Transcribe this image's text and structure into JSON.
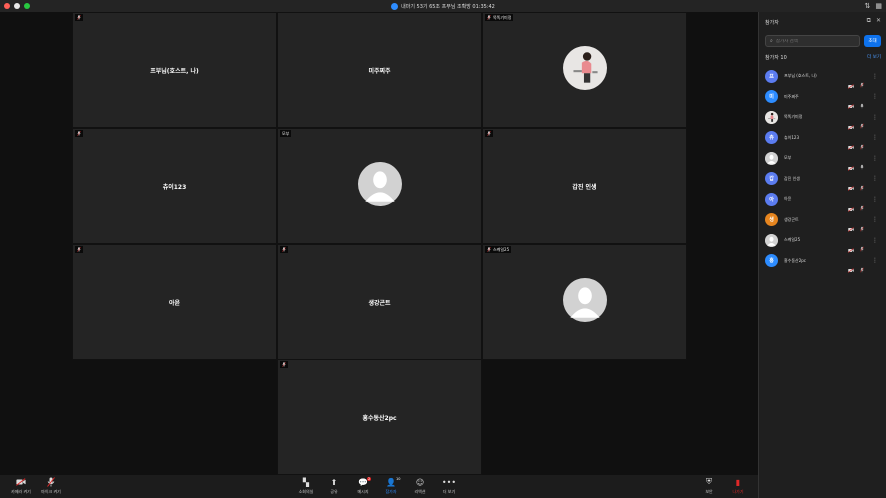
{
  "window": {
    "title": "내마기 53기 65조 프부님 조확방 01:35:42",
    "traffic": [
      "#ff5f57",
      "#e8e8e8",
      "#28c840"
    ]
  },
  "tiles": [
    {
      "name": "프부님(호스트, 나)",
      "label": "",
      "muted": true,
      "type": "name"
    },
    {
      "name": "미주찌주",
      "label": "",
      "muted": false,
      "type": "name"
    },
    {
      "name": "",
      "label": "똑똑기미정",
      "muted": true,
      "type": "photo"
    },
    {
      "name": "츄이123",
      "label": "",
      "muted": true,
      "type": "name"
    },
    {
      "name": "",
      "label": "모부",
      "muted": false,
      "type": "silhouette"
    },
    {
      "name": "갑진 인생",
      "label": "",
      "muted": true,
      "type": "name"
    },
    {
      "name": "아윤",
      "label": "",
      "muted": true,
      "type": "name"
    },
    {
      "name": "생강곤트",
      "label": "",
      "muted": true,
      "type": "name"
    },
    {
      "name": "",
      "label": "스케일25",
      "muted": true,
      "type": "silhouette"
    },
    {
      "name": "흥수동산2pc",
      "label": "",
      "muted": true,
      "type": "name"
    }
  ],
  "toolbar": {
    "left": [
      {
        "label": "카메라 켜기",
        "icon": "camera-off-icon"
      },
      {
        "label": "마이크 켜기",
        "icon": "mic-off-icon"
      }
    ],
    "center": [
      {
        "label": "소회의실",
        "icon": "breakout-icon"
      },
      {
        "label": "공유",
        "icon": "share-icon"
      },
      {
        "label": "메시지",
        "icon": "chat-icon",
        "badge": "2"
      },
      {
        "label": "참가자",
        "icon": "participants-icon",
        "badge": "10"
      },
      {
        "label": "리액션",
        "icon": "reaction-icon"
      },
      {
        "label": "더 보기",
        "icon": "more-icon"
      }
    ],
    "right": [
      {
        "label": "보안",
        "icon": "security-icon"
      },
      {
        "label": "나가기",
        "icon": "leave-icon"
      }
    ]
  },
  "panel": {
    "title": "참가자",
    "search_placeholder": "참가자 검색",
    "invite_label": "초대",
    "count_label": "참가자 10",
    "more_label": "더 보기",
    "participants": [
      {
        "initial": "프",
        "name": "프부님 (호스트, 나)",
        "color": "#5b7cf0",
        "mic": "off"
      },
      {
        "initial": "미",
        "name": "미주찌주",
        "color": "#2d8cff",
        "mic": "on"
      },
      {
        "initial": "",
        "name": "똑똑기미정",
        "color": "#e8e0e0",
        "mic": "off",
        "photo": true
      },
      {
        "initial": "츄",
        "name": "츄이123",
        "color": "#5b7cf0",
        "mic": "off"
      },
      {
        "initial": "",
        "name": "모부",
        "color": "#cfcfcf",
        "mic": "on",
        "silhouette": true
      },
      {
        "initial": "갑",
        "name": "갑진 인생",
        "color": "#5b7cf0",
        "mic": "off"
      },
      {
        "initial": "아",
        "name": "아윤",
        "color": "#5b7cf0",
        "mic": "off"
      },
      {
        "initial": "생",
        "name": "생강곤트",
        "color": "#e6851f",
        "mic": "off"
      },
      {
        "initial": "",
        "name": "스케일25",
        "color": "#cfcfcf",
        "mic": "off",
        "silhouette": true
      },
      {
        "initial": "흥",
        "name": "흥수동산2pc",
        "color": "#2d8cff",
        "mic": "off"
      }
    ]
  }
}
